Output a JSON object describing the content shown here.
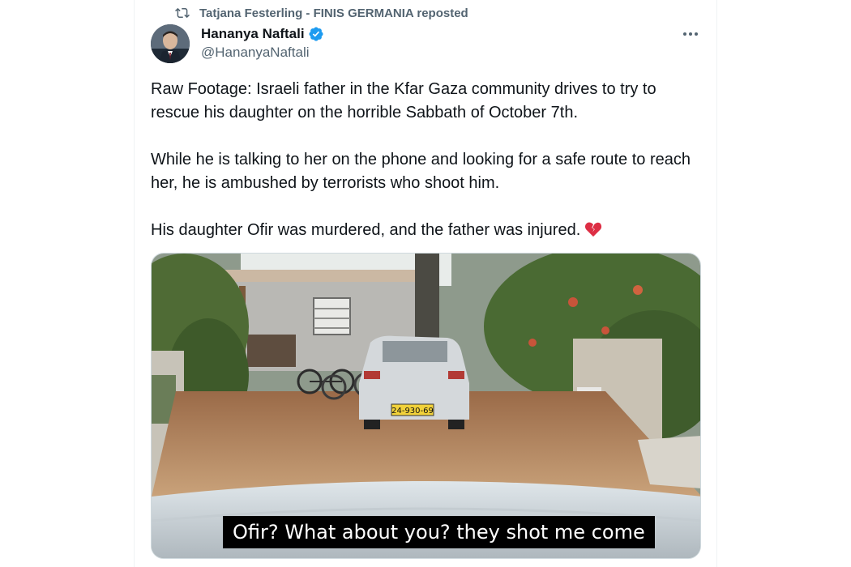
{
  "repost": {
    "text": "Tatjana Festerling - FINIS GERMANIA reposted",
    "icon": "repost-icon"
  },
  "author": {
    "name": "Hananya Naftali",
    "handle": "@HananyaNaftali",
    "verified": true,
    "verified_color": "#1d9bf0"
  },
  "more_icon": "more-horizontal-icon",
  "tweet": {
    "paragraph_1": "Raw Footage: Israeli father in the Kfar Gaza community drives to try to rescue his daughter on the horrible Sabbath of October 7th.",
    "paragraph_2": "While he is talking to her on the phone and looking for a safe route to reach her, he is ambushed by terrorists who shoot him.",
    "paragraph_3": "His daughter Ofir was murdered, and the father was injured.",
    "emoji": "broken-heart-icon"
  },
  "media": {
    "subtitle": "Ofir?  What about you?  they shot me come",
    "license_plate": "24-930-69"
  },
  "colors": {
    "text_primary": "#0f1419",
    "text_secondary": "#536471",
    "border": "#eff3f4"
  }
}
